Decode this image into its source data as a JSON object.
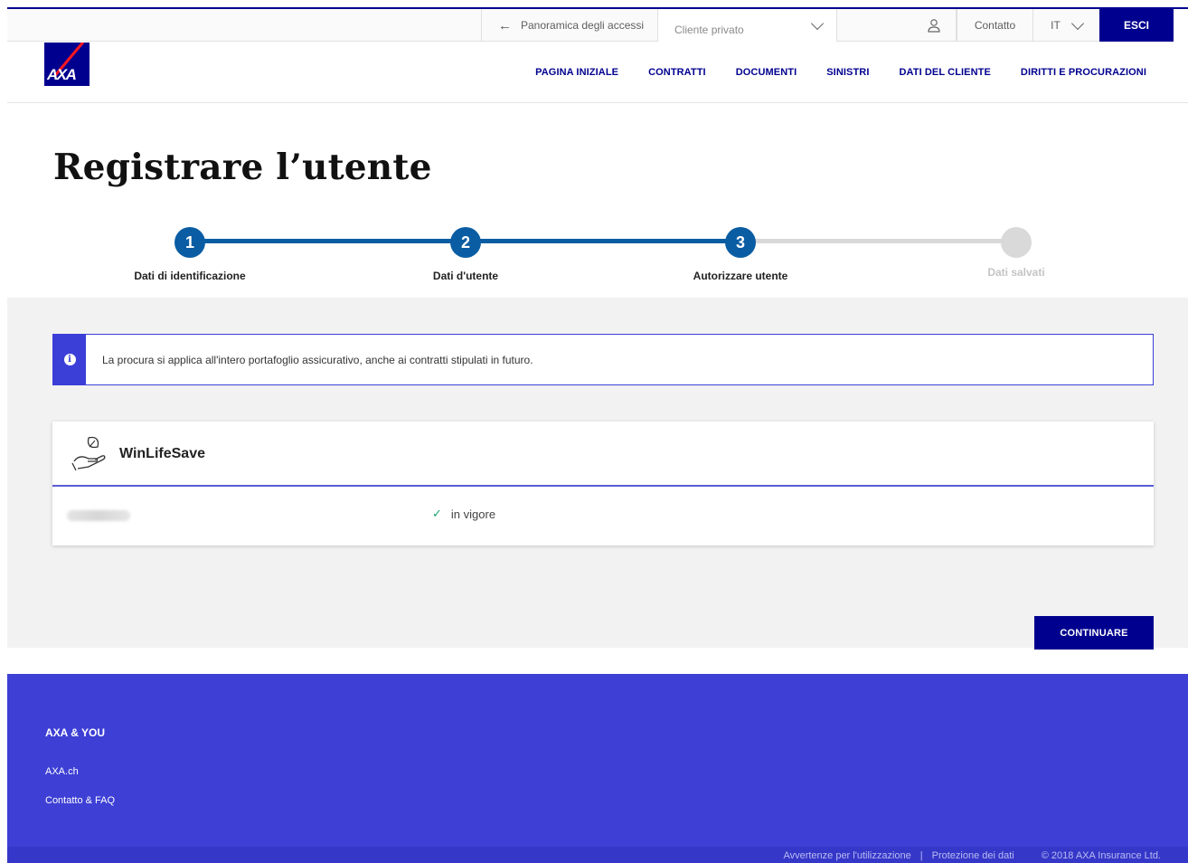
{
  "utility_bar": {
    "back_label": "Panoramica degli accessi",
    "client_select_value": "Cliente privato",
    "contact_label": "Contatto",
    "language_value": "IT",
    "exit_label": "ESCI"
  },
  "logo": {
    "text": "AXA"
  },
  "nav": {
    "items": [
      {
        "label": "PAGINA INIZIALE"
      },
      {
        "label": "CONTRATTI"
      },
      {
        "label": "DOCUMENTI"
      },
      {
        "label": "SINISTRI"
      },
      {
        "label": "DATI DEL CLIENTE"
      },
      {
        "label": "DIRITTI E PROCURAZIONI"
      }
    ]
  },
  "page": {
    "title": "Registrare l’utente"
  },
  "stepper": {
    "steps": [
      {
        "number": "1",
        "label": "Dati di identificazione",
        "state": "done"
      },
      {
        "number": "2",
        "label": "Dati d'utente",
        "state": "done"
      },
      {
        "number": "3",
        "label": "Autorizzare utente",
        "state": "active"
      },
      {
        "number": "",
        "label": "Dati salvati",
        "state": "pending"
      }
    ]
  },
  "info": {
    "text": "La procura si applica all'intero portafoglio assicurativo, anche ai contratti stipulati in futuro."
  },
  "contract_card": {
    "product_name": "WinLifeSave",
    "status": "in vigore"
  },
  "actions": {
    "continue_label": "CONTINUARE"
  },
  "footer": {
    "heading": "AXA & YOU",
    "links": [
      {
        "label": "AXA.ch"
      },
      {
        "label": "Contatto & FAQ"
      }
    ],
    "legal": {
      "disclaimer": "Avvertenze per l'utilizzazione",
      "privacy": "Protezione dei dati",
      "copyright": "© 2018 AXA Insurance Ltd."
    }
  },
  "colors": {
    "brand_blue": "#00008f",
    "accent_blue": "#3b3fd8",
    "step_blue": "#0a5da3",
    "footer_blue": "#3d3fd5",
    "success_green": "#1aa36e"
  }
}
